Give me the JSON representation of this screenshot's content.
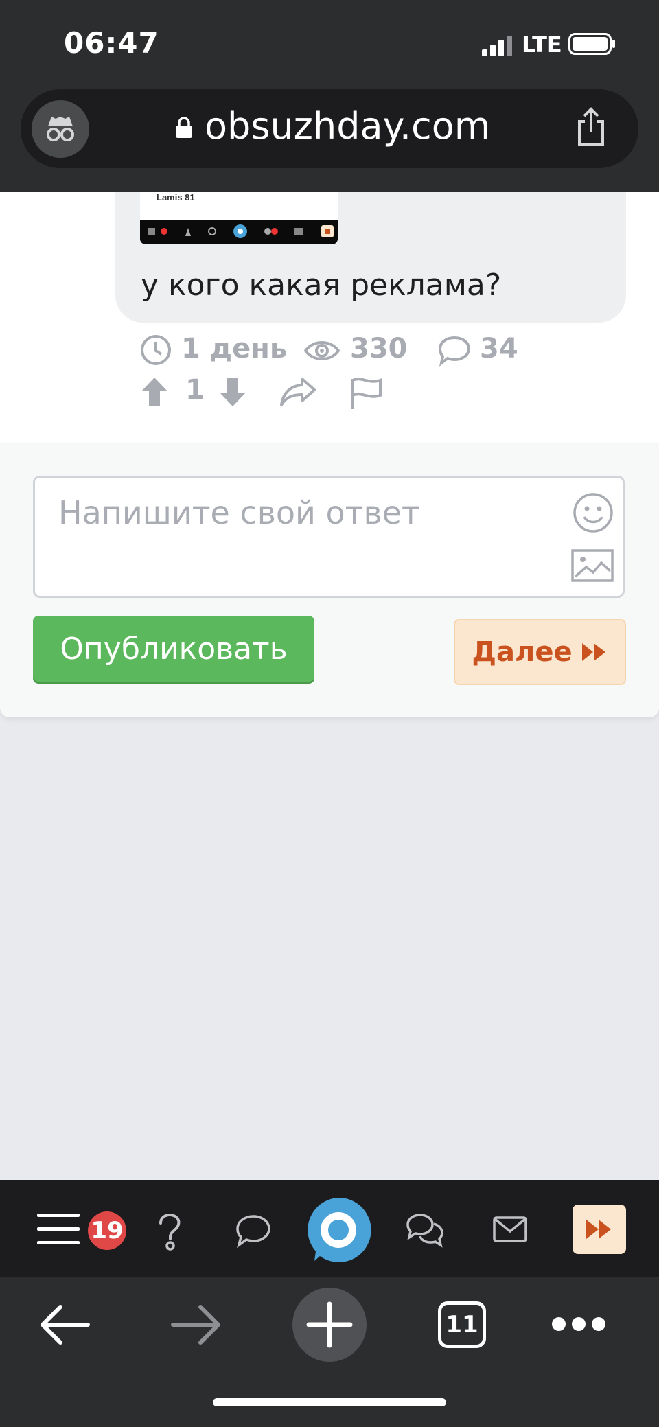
{
  "status": {
    "time": "06:47",
    "network": "LTE"
  },
  "browser": {
    "url": "obsuzhday.com",
    "tab_count": "11"
  },
  "post": {
    "image_caption": "Lamis 81",
    "text": "у кого какая реклама?",
    "age": "1 день",
    "views": "330",
    "comments": "34",
    "votes": "1"
  },
  "reply": {
    "placeholder": "Напишите свой ответ",
    "publish_label": "Опубликовать",
    "next_label": "Далее"
  },
  "app_nav": {
    "notifications": "19"
  },
  "colors": {
    "primary_green": "#5cb85c",
    "next_text": "#c9521f",
    "next_bg": "#fbe6cf",
    "badge_red": "#e04848",
    "accent_blue": "#4aa3d8"
  }
}
